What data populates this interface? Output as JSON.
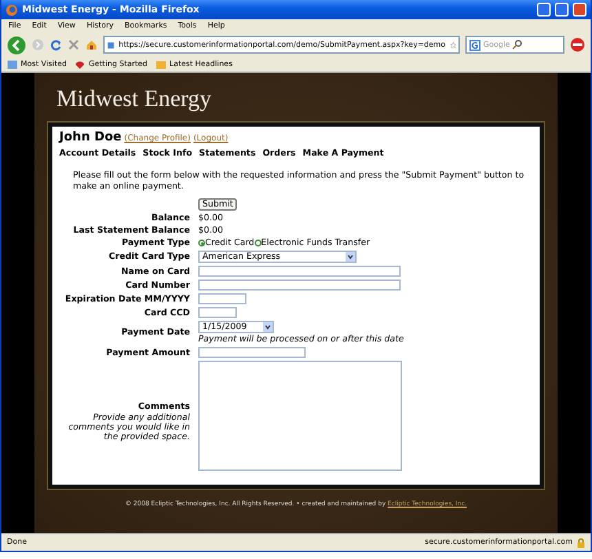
{
  "window": {
    "title": "Midwest Energy - Mozilla Firefox"
  },
  "menu": [
    "File",
    "Edit",
    "View",
    "History",
    "Bookmarks",
    "Tools",
    "Help"
  ],
  "toolbar": {
    "url": "https://secure.customerinformationportal.com/demo/SubmitPayment.aspx?key=demo",
    "search_placeholder": "Google"
  },
  "bookmarks": [
    "Most Visited",
    "Getting Started",
    "Latest Headlines"
  ],
  "site": {
    "title": "Midwest Energy",
    "user": "John Doe",
    "user_links": [
      "(Change Profile)",
      "(Logout)"
    ],
    "nav": [
      "Account Details",
      "Stock Info",
      "Statements",
      "Orders",
      "Make A Payment"
    ],
    "intro": "Please fill out the form below with the requested information and press the \"Submit Payment\" button to make an online payment.",
    "submit": "Submit",
    "rows": [
      {
        "kind": "text",
        "label": "Balance",
        "value": "$0.00"
      },
      {
        "kind": "text",
        "label": "Last Statement Balance",
        "value": "$0.00"
      },
      {
        "kind": "radio",
        "label": "Payment Type",
        "options": [
          {
            "label": "Credit Card",
            "selected": true
          },
          {
            "label": "Electronic Funds Transfer",
            "selected": false
          }
        ]
      },
      {
        "kind": "select",
        "label": "Credit Card Type",
        "value": "American Express"
      },
      {
        "kind": "input",
        "label": "Name on Card"
      },
      {
        "kind": "input",
        "label": "Card Number"
      },
      {
        "kind": "input",
        "label": "Expiration Date MM/YYYY"
      },
      {
        "kind": "input",
        "label": "Card CCD"
      },
      {
        "kind": "date",
        "label": "Payment Date",
        "value": "1/15/2009",
        "note": "Payment will be processed on or after this date"
      },
      {
        "kind": "input",
        "label": "Payment Amount"
      },
      {
        "kind": "textarea",
        "label": "Comments",
        "hint": "Provide any additional comments you would like in the provided space."
      }
    ],
    "footer": {
      "text": "© 2008 Ecliptic Technologies, Inc. All Rights Reserved. • created and maintained by",
      "link": "Ecliptic Technologies, Inc."
    }
  },
  "status_bar": {
    "left": "Done",
    "right": "secure.customerinformationportal.com"
  }
}
